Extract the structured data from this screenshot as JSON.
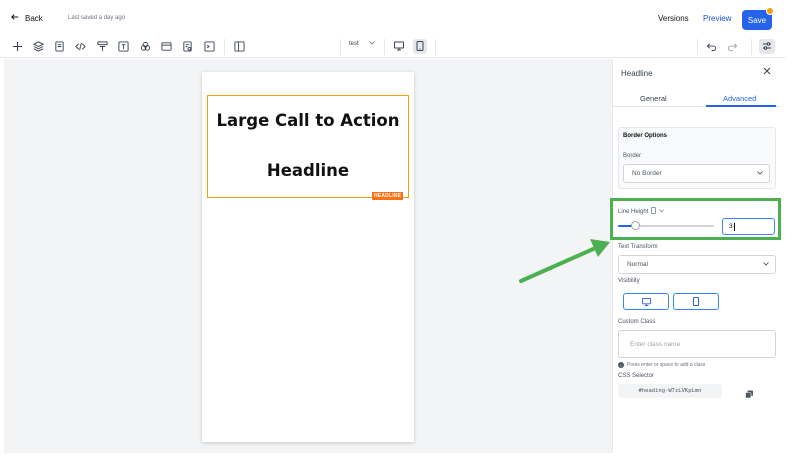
{
  "topbar": {
    "back_label": "Back",
    "saved_status": "Last saved a day ago",
    "versions_label": "Versions",
    "preview_label": "Preview",
    "save_label": "Save"
  },
  "toolbar": {
    "device_select_value": "test",
    "tools": [
      "add-icon",
      "layers-icon",
      "pages-icon",
      "code-icon",
      "components-icon",
      "text-icon",
      "shapes-icon",
      "section-icon",
      "form-icon",
      "terminal-icon",
      "columns-icon"
    ]
  },
  "canvas": {
    "headline_line1": "Large Call to Action",
    "headline_line2": "Headline",
    "element_tag": "HEADLINE"
  },
  "panel": {
    "title": "Headline",
    "tabs": [
      {
        "label": "General",
        "active": false
      },
      {
        "label": "Advanced",
        "active": true
      }
    ],
    "border_options": {
      "header": "Border Options",
      "border_label": "Border",
      "border_value": "No Border"
    },
    "line_height": {
      "label": "Line Height",
      "value": "3",
      "slider_fraction": 0.18
    },
    "text_transform": {
      "label": "Text Transform",
      "value": "Normal"
    },
    "visibility": {
      "label": "Visibility"
    },
    "custom_class": {
      "label": "Custom Class",
      "placeholder": "Enter class name",
      "hint": "Press enter or space to add a class"
    },
    "css_selector": {
      "label": "CSS Selector",
      "value": "#heading-W7zLVKpLmn"
    }
  },
  "colors": {
    "accent": "#2563eb",
    "highlight": "#4caf50",
    "selection": "#f59e0b",
    "tag": "#f97316"
  }
}
